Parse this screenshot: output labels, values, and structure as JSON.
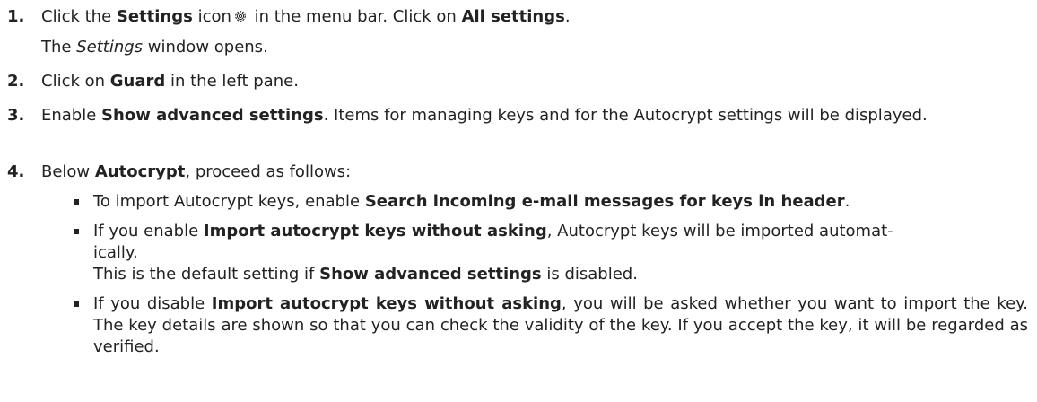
{
  "steps": [
    {
      "number": "1.",
      "parts": [
        "Click the ",
        "Settings",
        " icon",
        " in the menu bar. Click on ",
        "All settings",
        "."
      ],
      "result": [
        "The ",
        "Settings",
        " window opens."
      ]
    },
    {
      "number": "2.",
      "parts": [
        "Click on ",
        "Guard",
        " in the left pane."
      ]
    },
    {
      "number": "3.",
      "parts": [
        "Enable ",
        "Show advanced settings",
        ". Items for managing keys and for the Autocrypt settings will be displayed."
      ]
    },
    {
      "number": "4.",
      "parts": [
        "Below ",
        "Autocrypt",
        ", proceed as follows:"
      ],
      "bullets": [
        {
          "parts": [
            "To import Autocrypt keys, enable ",
            "Search incoming e-mail messages for keys in header",
            "."
          ]
        },
        {
          "parts": [
            "If you enable ",
            "Import autocrypt keys without asking",
            ", Autocrypt keys will be imported automat-",
            "ically."
          ],
          "note": [
            "This is the default setting if ",
            "Show advanced settings",
            " is disabled."
          ]
        },
        {
          "parts": [
            "If you disable ",
            "Import autocrypt keys without asking",
            ", you will be asked whether you want to import the key. The key details are shown so that you can check the validity of the key. If you accept the key, it will be regarded as verified."
          ]
        }
      ]
    }
  ],
  "icons": {
    "settings": "gear-icon"
  }
}
